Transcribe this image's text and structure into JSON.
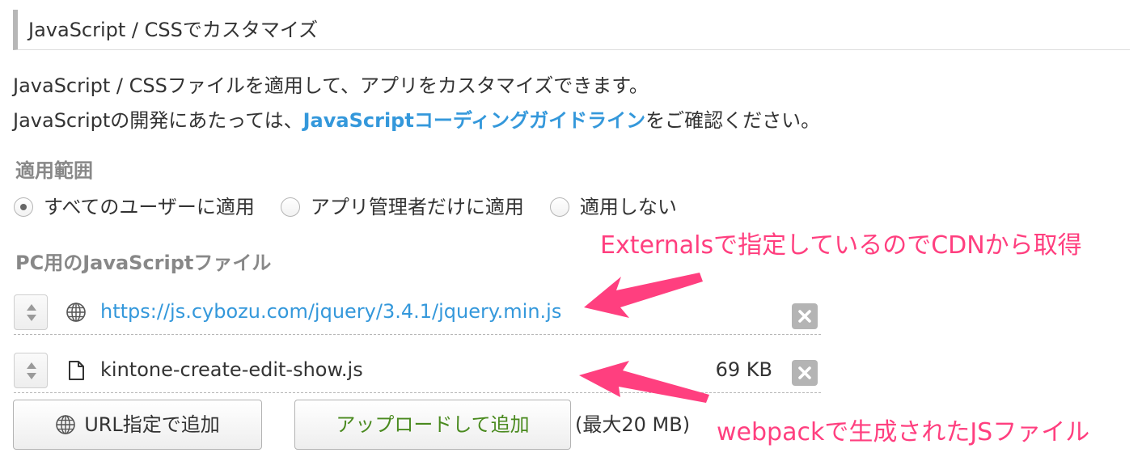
{
  "section": {
    "title": "JavaScript / CSSでカスタマイズ"
  },
  "description": {
    "line1": "JavaScript / CSSファイルを適用して、アプリをカスタマイズできます。",
    "line2_before": "JavaScriptの開発にあたっては、",
    "line2_link": "JavaScriptコーディングガイドライン",
    "line2_after": "をご確認ください。"
  },
  "scope": {
    "label": "適用範囲",
    "options": [
      {
        "label": "すべてのユーザーに適用",
        "checked": true
      },
      {
        "label": "アプリ管理者だけに適用",
        "checked": false
      },
      {
        "label": "適用しない",
        "checked": false
      }
    ]
  },
  "pc_js": {
    "label": "PC用のJavaScriptファイル",
    "files": [
      {
        "name": "https://js.cybozu.com/jquery/3.4.1/jquery.min.js",
        "type": "url",
        "size": "",
        "icon": "globe-icon"
      },
      {
        "name": "kintone-create-edit-show.js",
        "type": "file",
        "size": "69 KB",
        "icon": "file-icon"
      }
    ]
  },
  "buttons": {
    "add_url": "URL指定で追加",
    "upload": "アップロードして追加",
    "size_limit": "(最大20 MB)"
  },
  "annotations": {
    "cdn_note": "Externalsで指定しているのでCDNから取得",
    "webpack_note": "webpackで生成されたJSファイル"
  },
  "colors": {
    "link": "#3498db",
    "annotation": "#ff3f7f",
    "upload_text": "#4a8a1f",
    "label_gray": "#888888"
  }
}
